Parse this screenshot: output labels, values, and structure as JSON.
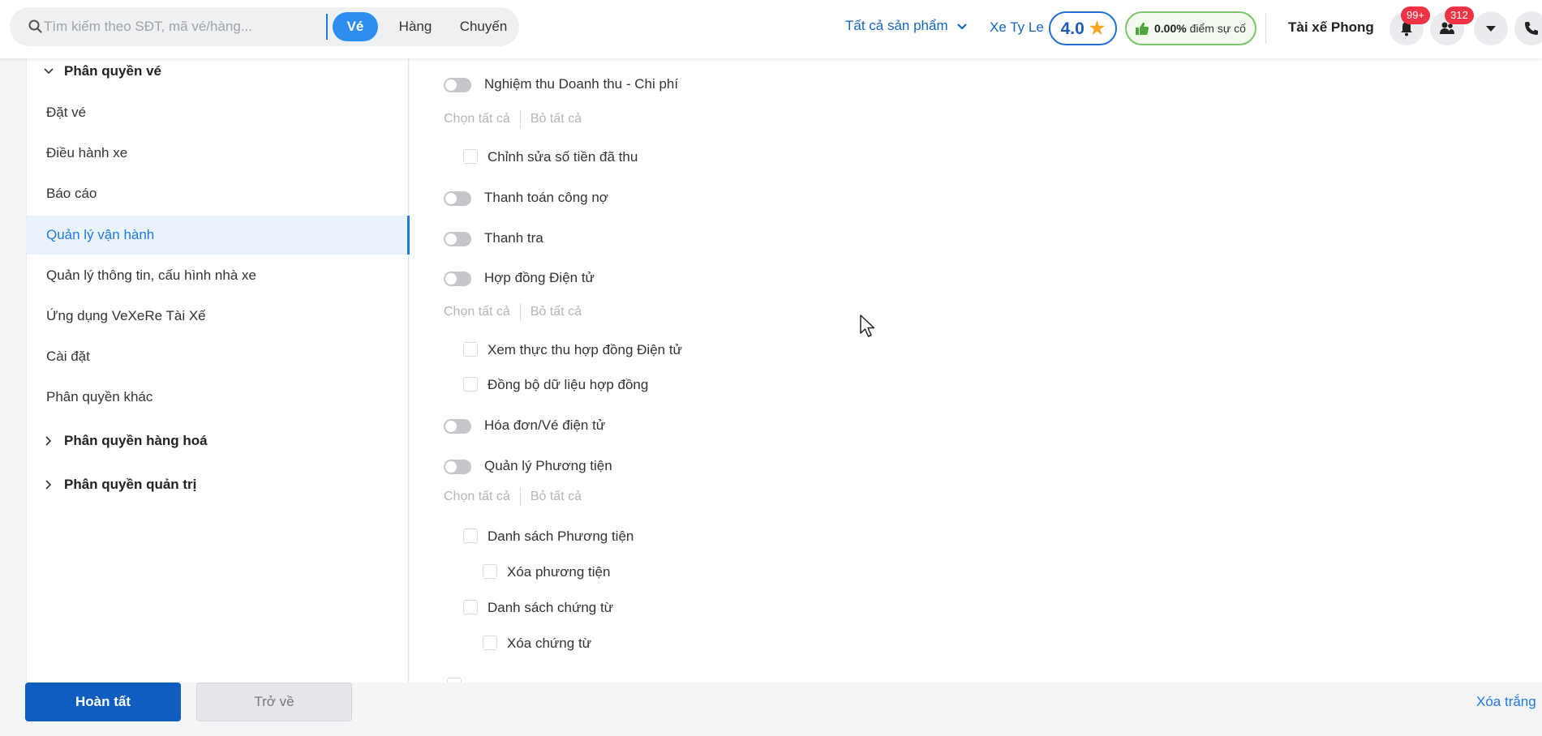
{
  "topbar": {
    "search": {
      "placeholder": "Tìm kiếm theo SĐT, mã vé/hàng..."
    },
    "tabs": [
      {
        "label": "Vé",
        "active": true
      },
      {
        "label": "Hàng",
        "active": false
      },
      {
        "label": "Chuyến",
        "active": false
      }
    ],
    "product_filter": "Tất cả sản phẩm",
    "company": "Xe Ty Le",
    "rating": "4.0",
    "incident": {
      "percent": "0.00%",
      "label": "điểm sự cố"
    },
    "driver": "Tài xế Phong",
    "notifications_badge": "99+",
    "contacts_badge": "312"
  },
  "sidebar": {
    "group_ticket": "Phân quyền vé",
    "items": [
      {
        "label": "Đặt vé",
        "active": false
      },
      {
        "label": "Điều hành xe",
        "active": false
      },
      {
        "label": "Báo cáo",
        "active": false
      },
      {
        "label": "Quản lý vận hành",
        "active": true
      },
      {
        "label": "Quản lý thông tin, cấu hình nhà xe",
        "active": false
      },
      {
        "label": "Ứng dụng VeXeRe Tài Xế",
        "active": false
      },
      {
        "label": "Cài đặt",
        "active": false
      },
      {
        "label": "Phân quyền khác",
        "active": false
      }
    ],
    "group_goods": "Phân quyền hàng hoá",
    "group_admin": "Phân quyền quản trị"
  },
  "content": {
    "select_all": "Chọn tất cả",
    "deselect_all": "Bỏ tất cả",
    "toggles": [
      "Nghiệm thu Doanh thu - Chi phí",
      "Thanh toán công nợ",
      "Thanh tra",
      "Hợp đồng Điện tử",
      "Hóa đơn/Vé điện tử",
      "Quản lý Phương tiện"
    ],
    "checks": [
      "Chỉnh sửa số tiền đã thu",
      "Xem thực thu hợp đồng Điện tử",
      "Đồng bộ dữ liệu hợp đồng",
      "Danh sách Phương tiện",
      "Xóa phương tiện",
      "Danh sách chứng từ",
      "Xóa chứng từ"
    ]
  },
  "footer": {
    "done": "Hoàn tất",
    "back": "Trở về",
    "clear": "Xóa trắng"
  }
}
